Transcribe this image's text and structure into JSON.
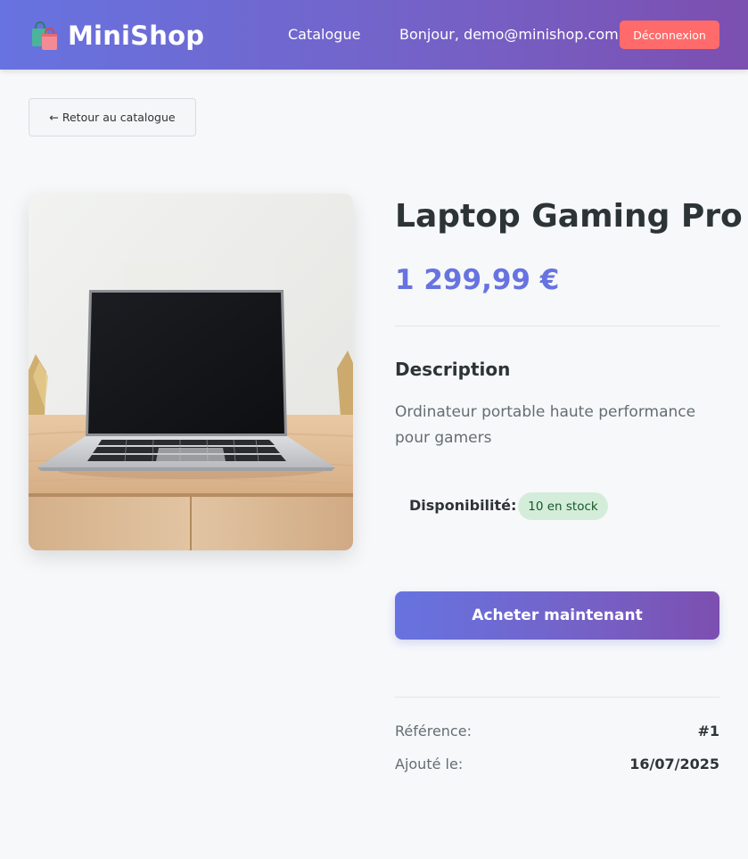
{
  "header": {
    "logo_icon": "shopping-bags-icon",
    "brand": "MiniShop",
    "nav_catalogue": "Catalogue",
    "greeting": "Bonjour, demo@minishop.com",
    "logout_label": "Déconnexion",
    "colors": {
      "gradient_start": "#6773e0",
      "gradient_end": "#7c4fb0",
      "logout": "#ff6b6b"
    }
  },
  "back_button": {
    "icon": "arrow-left-icon",
    "label": "← Retour au catalogue"
  },
  "product": {
    "image": "laptop-on-wooden-desk-photo",
    "title": "Laptop Gaming Pro",
    "price": "1 299,99 €",
    "description_heading": "Description",
    "description": "Ordinateur portable haute performance pour gamers",
    "availability_label": "Disponibilité:",
    "stock_badge": "10 en stock",
    "buy_label": "Acheter maintenant",
    "reference_label": "Référence:",
    "reference_value": "#1",
    "added_label": "Ajouté le:",
    "added_value": "16/07/2025"
  },
  "colors": {
    "accent": "#6773e0",
    "stock_bg": "#d4edda",
    "stock_text": "#155724"
  }
}
